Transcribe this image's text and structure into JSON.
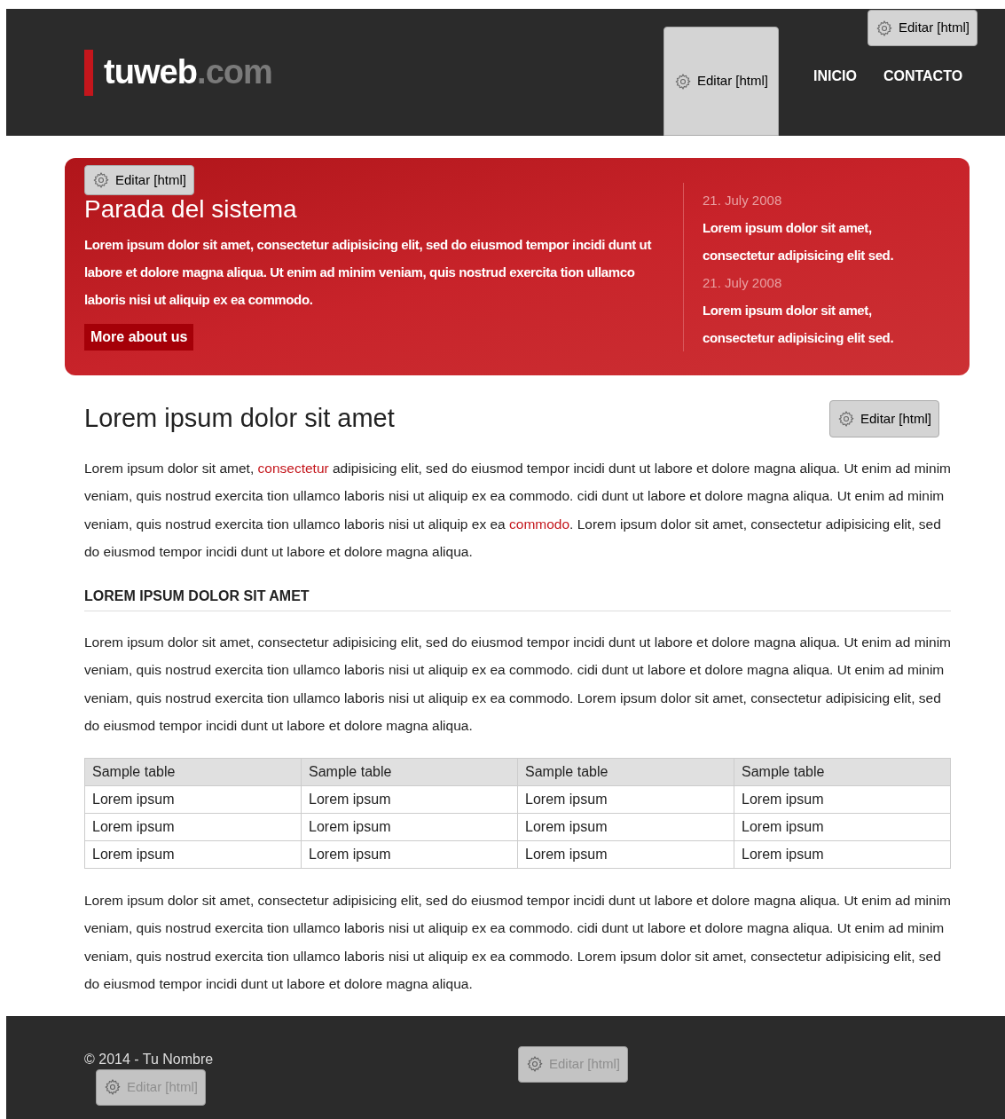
{
  "header": {
    "logo": {
      "name": "tuweb",
      "suffix": ".com"
    },
    "edit_buttons": [
      {
        "label": "Editar [html]",
        "disabled": false
      },
      {
        "label": "Editar [html]",
        "disabled": false
      }
    ],
    "nav": [
      {
        "label": "INICIO"
      },
      {
        "label": "CONTACTO"
      }
    ]
  },
  "hero": {
    "edit_button": {
      "label": "Editar [html]",
      "disabled": false
    },
    "title": "Parada del sistema",
    "text": "Lorem ipsum dolor sit amet, consectetur adipisicing elit, sed do eiusmod tempor incidi dunt ut labore et dolore magna aliqua. Ut enim ad minim veniam, quis nostrud exercita tion ullamco laboris nisi ut aliquip ex ea commodo.",
    "button": "More about us",
    "news": [
      {
        "date": "21. July 2008",
        "text": "Lorem ipsum dolor sit amet, consectetur adipisicing elit sed."
      },
      {
        "date": "21. July 2008",
        "text": "Lorem ipsum dolor sit amet, consectetur adipisicing elit sed."
      }
    ]
  },
  "content": {
    "title": "Lorem ipsum dolor sit amet",
    "edit_button": {
      "label": "Editar [html]",
      "disabled": false
    },
    "paragraph_1": [
      {
        "text": "Lorem ipsum dolor sit amet, ",
        "link": false
      },
      {
        "text": "consectetur",
        "link": true
      },
      {
        "text": " adipisicing elit, sed do eiusmod tempor incidi dunt ut labore et dolore magna aliqua. Ut enim ad minim veniam, quis nostrud exercita tion ullamco laboris nisi ut aliquip ex ea commodo. cidi dunt ut labore et dolore magna aliqua. Ut enim ad minim veniam, quis nostrud exercita tion ullamco laboris nisi ut aliquip ex ea ",
        "link": false
      },
      {
        "text": "commodo",
        "link": true
      },
      {
        "text": ". Lorem ipsum dolor sit amet, consectetur adipisicing elit, sed do eiusmod tempor incidi dunt ut labore et dolore magna aliqua.",
        "link": false
      }
    ],
    "subtitle": "LOREM IPSUM DOLOR SIT AMET",
    "paragraph_2": "Lorem ipsum dolor sit amet, consectetur adipisicing elit, sed do eiusmod tempor incidi dunt ut labore et dolore magna aliqua. Ut enim ad minim veniam, quis nostrud exercita tion ullamco laboris nisi ut aliquip ex ea commodo. cidi dunt ut labore et dolore magna aliqua. Ut enim ad minim veniam, quis nostrud exercita tion ullamco laboris nisi ut aliquip ex ea commodo. Lorem ipsum dolor sit amet, consectetur adipisicing elit, sed do eiusmod tempor incidi dunt ut labore et dolore magna aliqua.",
    "table": {
      "columns": [
        "Sample table",
        "Sample table",
        "Sample table",
        "Sample table"
      ],
      "rows": [
        [
          "Lorem ipsum",
          "Lorem ipsum",
          "Lorem ipsum",
          "Lorem ipsum"
        ],
        [
          "Lorem ipsum",
          "Lorem ipsum",
          "Lorem ipsum",
          "Lorem ipsum"
        ],
        [
          "Lorem ipsum",
          "Lorem ipsum",
          "Lorem ipsum",
          "Lorem ipsum"
        ]
      ]
    },
    "paragraph_3": "Lorem ipsum dolor sit amet, consectetur adipisicing elit, sed do eiusmod tempor incidi dunt ut labore et dolore magna aliqua. Ut enim ad minim veniam, quis nostrud exercita tion ullamco laboris nisi ut aliquip ex ea commodo. cidi dunt ut labore et dolore magna aliqua. Ut enim ad minim veniam, quis nostrud exercita tion ullamco laboris nisi ut aliquip ex ea commodo. Lorem ipsum dolor sit amet, consectetur adipisicing elit, sed do eiusmod tempor incidi dunt ut labore et dolore magna aliqua."
  },
  "footer": {
    "copyright": "© 2014 - Tu Nombre",
    "edit_buttons": [
      {
        "label": "Editar [html]",
        "disabled": true
      },
      {
        "label": "Editar [html]",
        "disabled": true
      }
    ]
  }
}
